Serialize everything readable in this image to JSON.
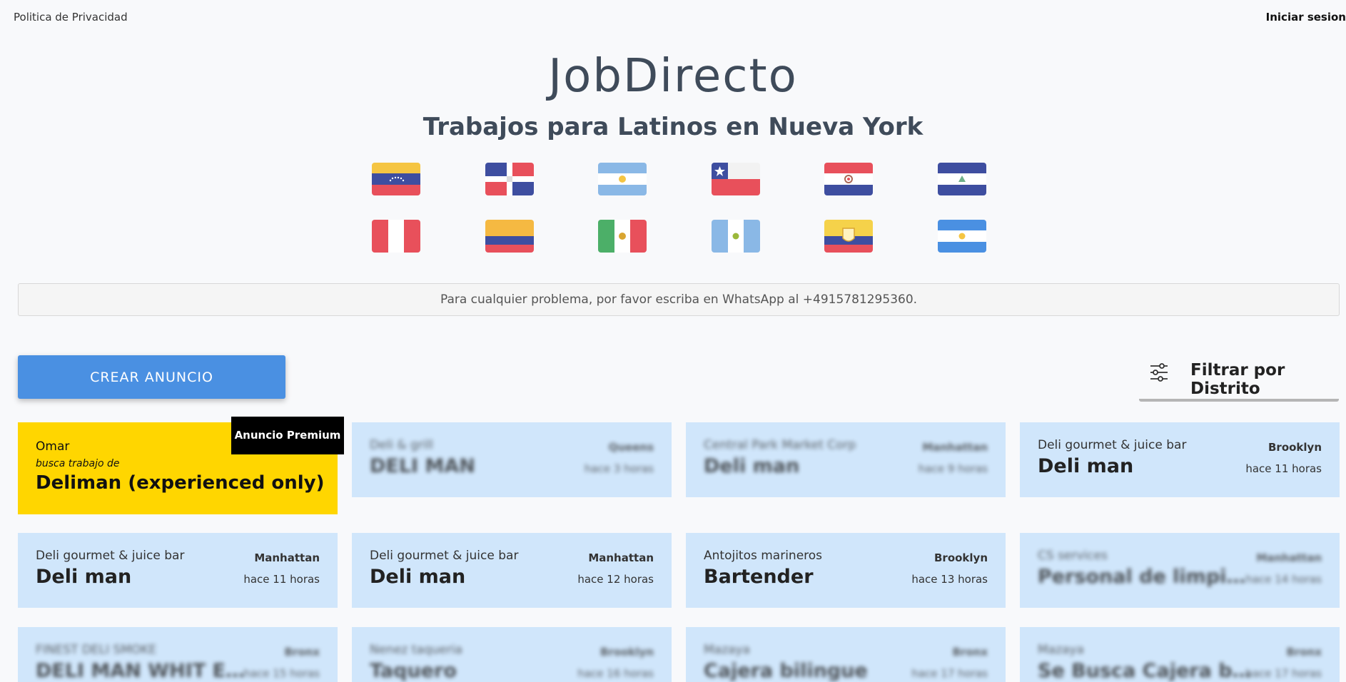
{
  "header": {
    "privacy_link": "Politica de Privacidad",
    "login_link": "Iniciar sesion"
  },
  "brand": {
    "logo": "JobDirecto",
    "subtitle": "Trabajos para Latinos en Nueva York"
  },
  "flags": [
    {
      "country": "venezuela-flag"
    },
    {
      "country": "dominican-republic-flag"
    },
    {
      "country": "argentina-flag"
    },
    {
      "country": "chile-flag"
    },
    {
      "country": "paraguay-flag"
    },
    {
      "country": "nicaragua-flag"
    },
    {
      "country": "peru-flag"
    },
    {
      "country": "colombia-flag"
    },
    {
      "country": "mexico-flag"
    },
    {
      "country": "guatemala-flag"
    },
    {
      "country": "ecuador-flag"
    },
    {
      "country": "honduras-flag"
    }
  ],
  "notice": "Para cualquier problema, por favor escriba en WhatsApp al +4915781295360.",
  "actions": {
    "create_label": "CREAR ANUNCIO",
    "filter_label": "Filtrar por Distrito"
  },
  "premium": {
    "badge": "Anuncio Premium",
    "name": "Omar",
    "seeks": "busca trabajo de",
    "title": "Deliman (experienced only)"
  },
  "listings": [
    {
      "company": "Deli & grill",
      "title": "DELI MAN",
      "district": "Queens",
      "time": "hace 3 horas"
    },
    {
      "company": "Central Park Market Corp",
      "title": "Deli man",
      "district": "Manhattan",
      "time": "hace 9 horas"
    },
    {
      "company": "Deli gourmet & juice bar",
      "title": "Deli man",
      "district": "Brooklyn",
      "time": "hace 11 horas"
    },
    {
      "company": "Deli gourmet & juice bar",
      "title": "Deli man",
      "district": "Manhattan",
      "time": "hace 11 horas"
    },
    {
      "company": "Deli gourmet & juice bar",
      "title": "Deli man",
      "district": "Manhattan",
      "time": "hace 12 horas"
    },
    {
      "company": "Antojitos marineros",
      "title": "Bartender",
      "district": "Brooklyn",
      "time": "hace 13 horas"
    },
    {
      "company": "CS services",
      "title": "Personal de limpiezas ...",
      "district": "Manhattan",
      "time": "hace 14 horas"
    },
    {
      "company": "FINEST DELI SMOKE",
      "title": "DELI MAN WHIT EXPE...",
      "district": "Bronx",
      "time": "hace 15 horas"
    },
    {
      "company": "Nenez taqueria",
      "title": "Taquero",
      "district": "Brooklyn",
      "time": "hace 16 horas"
    },
    {
      "company": "Mazaya",
      "title": "Cajera bilingue",
      "district": "Bronx",
      "time": "hace 17 horas"
    },
    {
      "company": "Mazaya",
      "title": "Se Busca Cajera biling...",
      "district": "Bronx",
      "time": "hace 17 horas"
    }
  ],
  "colors": {
    "accent": "#4a90e2",
    "card_bg": "#d0e6fb",
    "premium_bg": "#ffd600",
    "title_text": "#3f4b5a"
  }
}
